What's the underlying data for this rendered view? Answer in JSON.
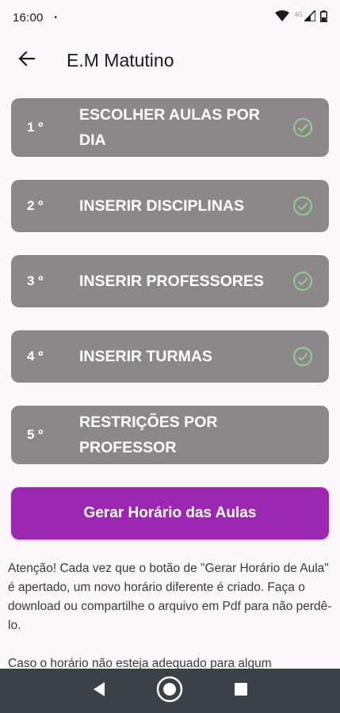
{
  "status_bar": {
    "time": "16:00",
    "dot": "•",
    "network_label": "4G",
    "icons": [
      "wifi-icon",
      "signal-icon",
      "battery-icon"
    ]
  },
  "app_bar": {
    "title": "E.M Matutino",
    "back_icon": "arrow-back-icon"
  },
  "steps": [
    {
      "number": "1 º",
      "label": "ESCOLHER AULAS POR DIA",
      "completed": true
    },
    {
      "number": "2 º",
      "label": "INSERIR DISCIPLINAS",
      "completed": true
    },
    {
      "number": "3 º",
      "label": "INSERIR PROFESSORES",
      "completed": true
    },
    {
      "number": "4 º",
      "label": "INSERIR TURMAS",
      "completed": true
    },
    {
      "number": "5 º",
      "label": "RESTRIÇÕES POR PROFESSOR",
      "completed": false
    }
  ],
  "generate_button": {
    "label": "Gerar Horário das Aulas"
  },
  "notice": {
    "text": "Atenção! Cada vez que o botão de \"Gerar Horário de Aula\" é apertado, um novo horário diferente é criado. Faça o download ou compartilhe o arquivo em Pdf para não perdê-lo.",
    "text_2": "Caso o horário não esteja adequado para algum"
  },
  "nav_bar": {
    "icons": [
      "nav-back-icon",
      "nav-home-icon",
      "nav-recents-icon"
    ]
  },
  "colors": {
    "card": "#8e8789",
    "accent": "#9c27b0",
    "check": "#8fd18f",
    "nav": "#3a4147"
  }
}
